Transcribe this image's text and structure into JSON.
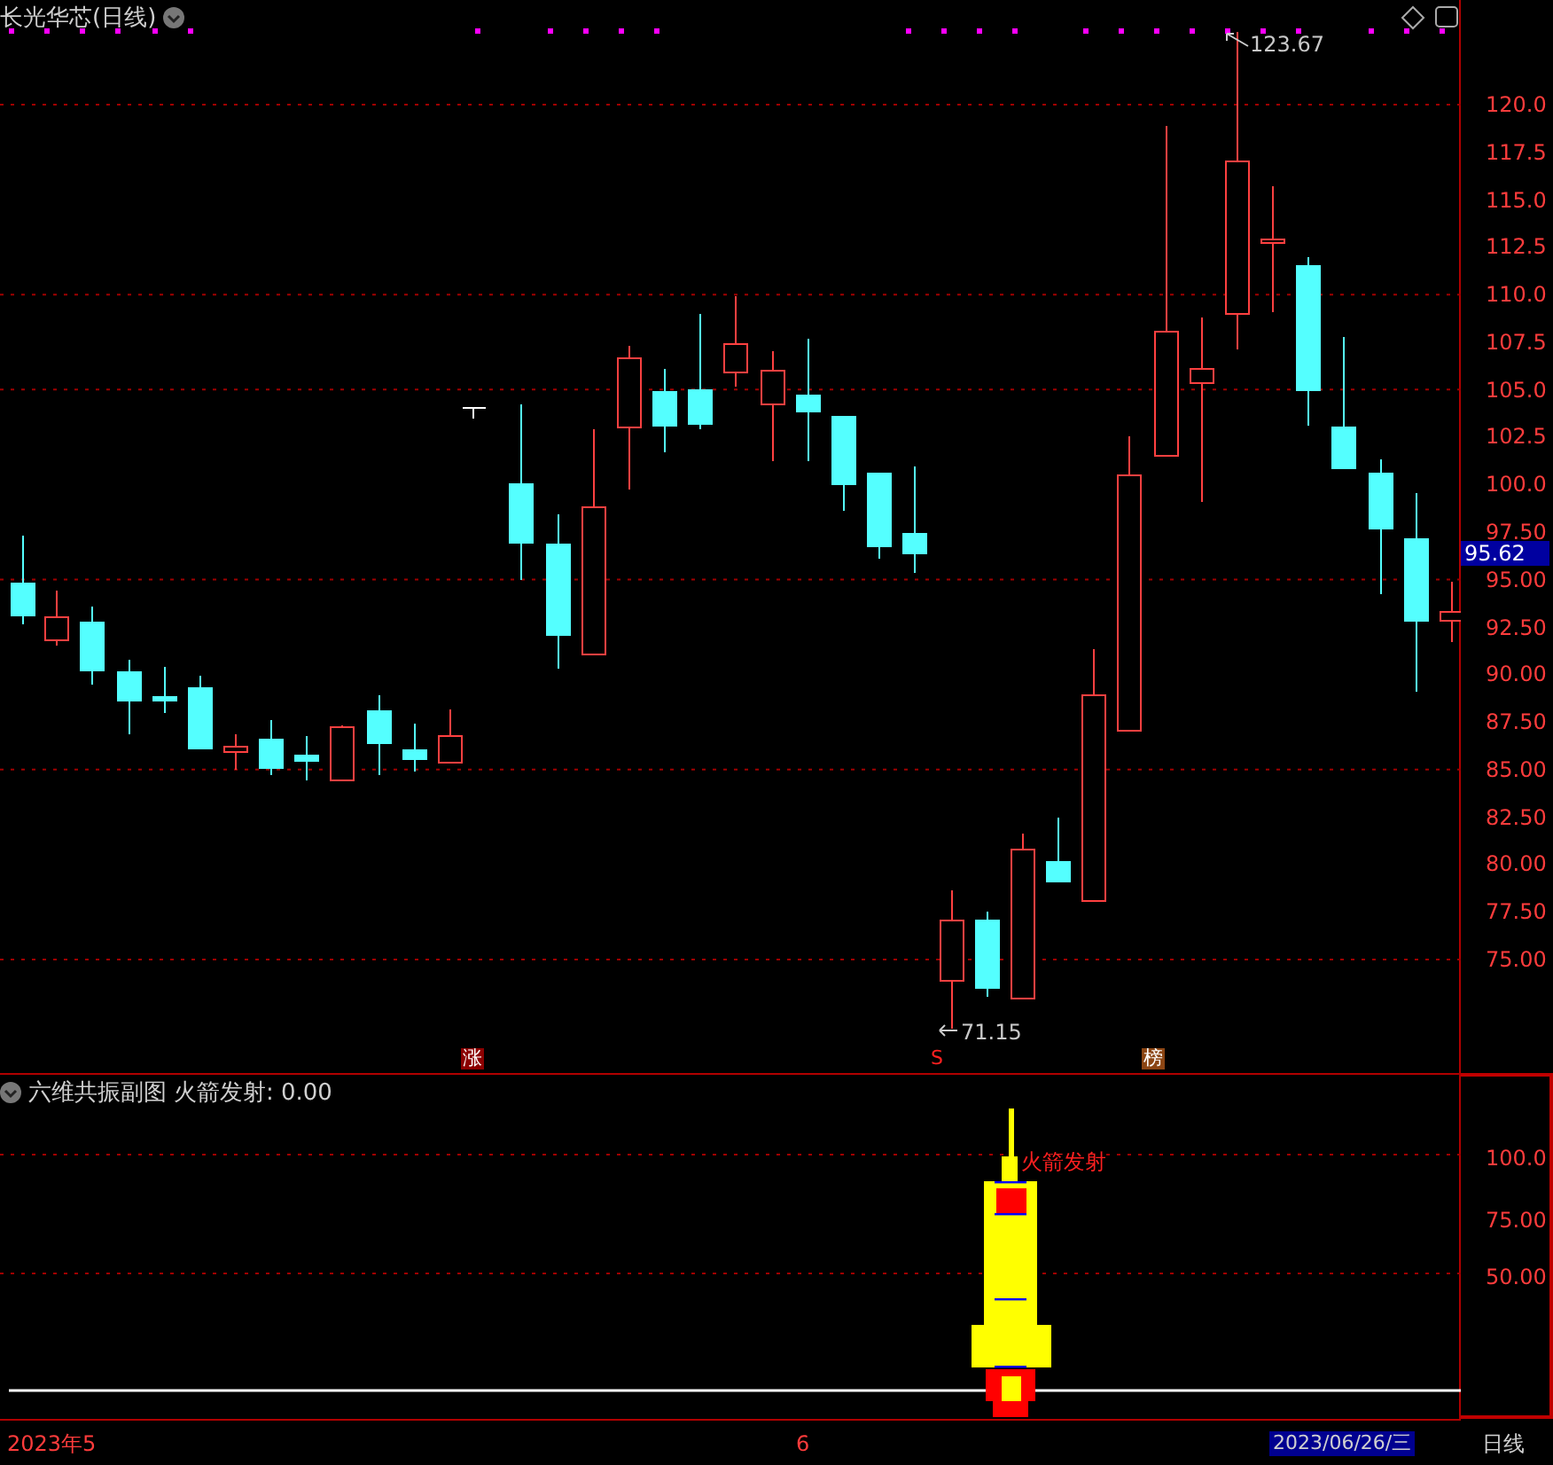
{
  "title": "长光华芯(日线)",
  "price_axis": [
    "120.0",
    "117.5",
    "115.0",
    "112.5",
    "110.0",
    "107.5",
    "105.0",
    "102.5",
    "100.0",
    "97.50",
    "95.00",
    "92.50",
    "90.00",
    "87.50",
    "85.00",
    "82.50",
    "80.00",
    "77.50",
    "75.00"
  ],
  "high_label": "123.67",
  "low_label": "71.15",
  "last_price": "95.62",
  "markers": [
    {
      "text": "涨",
      "kind": "rise"
    },
    {
      "text": "S",
      "kind": "sell"
    },
    {
      "text": "榜",
      "kind": "list"
    }
  ],
  "indicator": {
    "name": "六维共振副图",
    "value_label": "火箭发射: 0.00",
    "signal_label": "火箭发射",
    "axis": [
      "100.0",
      "75.00",
      "50.00"
    ]
  },
  "time_axis": {
    "labels": [
      "2023年5",
      "6"
    ],
    "cursor_date": "2023/06/26/三",
    "period": "日线"
  }
}
